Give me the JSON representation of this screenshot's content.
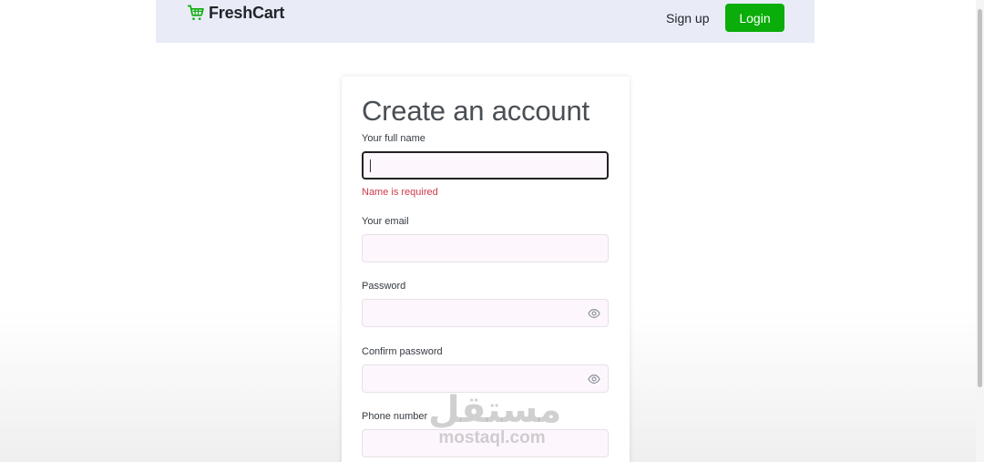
{
  "navbar": {
    "brand": "FreshCart",
    "signup_label": "Sign up",
    "login_label": "Login"
  },
  "form": {
    "title": "Create an account",
    "name_label": "Your full name",
    "name_value": "",
    "name_error": "Name is required",
    "email_label": "Your email",
    "password_label": "Password",
    "confirm_label": "Confirm password",
    "phone_label": "Phone number"
  },
  "watermark": {
    "arabic": "مستقل",
    "latin": "mostaql.com"
  },
  "colors": {
    "brand_green": "#0aad0a",
    "navbar_bg": "#e9ecf6",
    "error_red": "#cf3a4a",
    "input_bg": "#fdf7fd"
  }
}
